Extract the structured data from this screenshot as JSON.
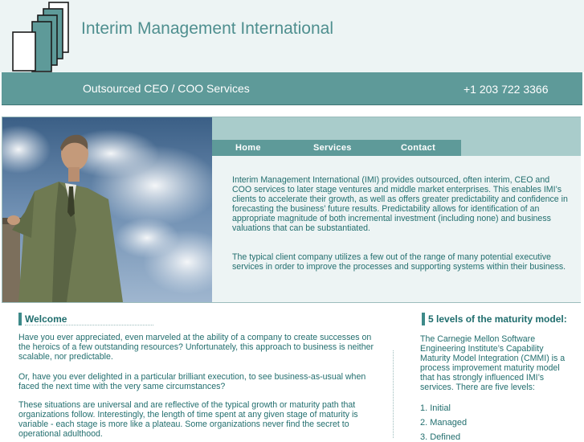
{
  "header": {
    "title": "Interim Management International",
    "tagline": "Outsourced CEO / COO Services",
    "phone": "+1 203 722 3366"
  },
  "nav": {
    "items": [
      "Home",
      "Services",
      "Contact"
    ]
  },
  "hero": {
    "paragraphs": [
      "Interim Management International (IMI) provides outsourced, often interim, CEO and COO services to later stage ventures and middle market enterprises.  This enables IMI’s clients to accelerate their growth, as well as offers greater predictability and confidence in forecasting the business’ future results.  Predictability allows for  identification of an appropriate magnitude of both incremental investment (including none) and business valuations that can be substantiated.",
      "The typical client company  utilizes a few out of the range of many potential executive services in order to improve the processes and supporting systems within their business."
    ]
  },
  "welcome": {
    "heading": "Welcome",
    "paragraphs": [
      "Have you ever appreciated, even marveled at the ability of a company to create successes on the heroics of a few outstanding resources? Unfortunately, this approach to business is neither scalable, nor predictable.",
      "Or, have you ever delighted in a particular brilliant execution, to see business-as-usual when faced the next time with the very same circumstances?",
      "These situations are universal and are reflective of the typical growth or maturity path that organizations follow.  Interestingly, the length of time spent at any given stage of maturity is variable - each stage is more like a plateau.  Some organizations never find the secret to operational adulthood."
    ]
  },
  "maturity": {
    "heading": "5 levels of the maturity model:",
    "intro": "The Carnegie Mellon Software Engineering Institute’s Capability Maturity Model Integration (CMMI) is a process improvement maturity model that has strongly influenced IMI’s services. There are five levels:",
    "levels": [
      "1. Initial",
      "2. Managed",
      "3. Defined"
    ]
  },
  "colors": {
    "brand_teal": "#5e9a99",
    "light_teal": "#a9cccb",
    "text_teal": "#226e6e",
    "pale_bg": "#edf4f4"
  }
}
